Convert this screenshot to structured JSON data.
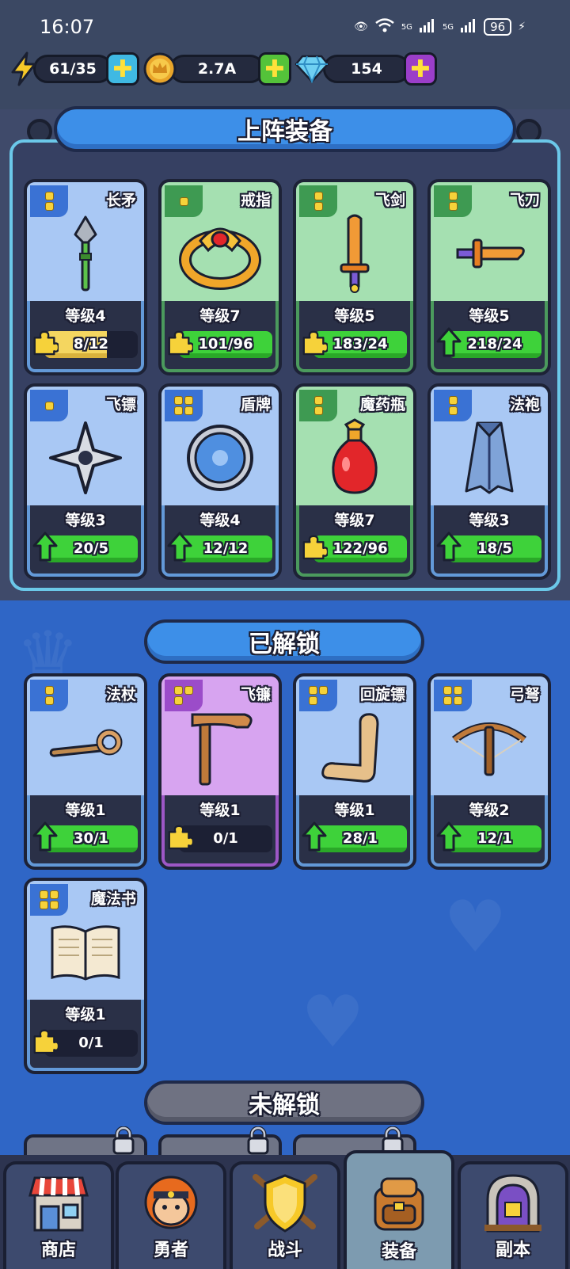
{
  "status_bar": {
    "time": "16:07",
    "battery": "96",
    "net1": "5G",
    "net2": "5G"
  },
  "currencies": [
    {
      "icon": "lightning-icon",
      "value": "61/35",
      "plus_color": "#3fb9e3"
    },
    {
      "icon": "crown-coin-icon",
      "value": "2.7A",
      "plus_color": "#54c33a"
    },
    {
      "icon": "diamond-icon",
      "value": "154",
      "plus_color": "#9b3ec9"
    }
  ],
  "equipped": {
    "title": "上阵装备",
    "items": [
      {
        "name": "长矛",
        "level": "等级4",
        "progress": "8/12",
        "fill": 0.67,
        "color": "blue",
        "badge": "puzzle",
        "rarity": 2,
        "icon": "spear-icon"
      },
      {
        "name": "戒指",
        "level": "等级7",
        "progress": "101/96",
        "fill": 1.0,
        "color": "green",
        "badge": "puzzle",
        "rarity": 1,
        "icon": "ring-icon"
      },
      {
        "name": "飞剑",
        "level": "等级5",
        "progress": "183/24",
        "fill": 1.0,
        "color": "green",
        "badge": "puzzle",
        "rarity": 2,
        "icon": "sword-icon"
      },
      {
        "name": "飞刀",
        "level": "等级5",
        "progress": "218/24",
        "fill": 1.0,
        "color": "green",
        "badge": "arrow",
        "rarity": 2,
        "icon": "dagger-icon"
      },
      {
        "name": "飞镖",
        "level": "等级3",
        "progress": "20/5",
        "fill": 1.0,
        "color": "blue",
        "badge": "arrow",
        "rarity": 1,
        "icon": "shuriken-icon"
      },
      {
        "name": "盾牌",
        "level": "等级4",
        "progress": "12/12",
        "fill": 1.0,
        "color": "blue",
        "badge": "arrow",
        "rarity": 4,
        "icon": "shield-icon"
      },
      {
        "name": "魔药瓶",
        "level": "等级7",
        "progress": "122/96",
        "fill": 1.0,
        "color": "green",
        "badge": "puzzle",
        "rarity": 2,
        "icon": "potion-icon"
      },
      {
        "name": "法袍",
        "level": "等级3",
        "progress": "18/5",
        "fill": 1.0,
        "color": "blue",
        "badge": "arrow",
        "rarity": 2,
        "icon": "robe-icon"
      }
    ]
  },
  "unlocked": {
    "title": "已解锁",
    "items": [
      {
        "name": "法杖",
        "level": "等级1",
        "progress": "30/1",
        "fill": 1.0,
        "color": "blue",
        "badge": "arrow",
        "rarity": 2,
        "icon": "staff-icon"
      },
      {
        "name": "飞镰",
        "level": "等级1",
        "progress": "0/1",
        "fill": 0.0,
        "color": "purple",
        "badge": "puzzle",
        "rarity": 3,
        "icon": "scythe-icon"
      },
      {
        "name": "回旋镖",
        "level": "等级1",
        "progress": "28/1",
        "fill": 1.0,
        "color": "blue",
        "badge": "arrow",
        "rarity": 3,
        "icon": "boomerang-icon"
      },
      {
        "name": "弓弩",
        "level": "等级2",
        "progress": "12/1",
        "fill": 1.0,
        "color": "blue",
        "badge": "arrow",
        "rarity": 4,
        "icon": "crossbow-icon"
      },
      {
        "name": "魔法书",
        "level": "等级1",
        "progress": "0/1",
        "fill": 0.0,
        "color": "blue",
        "badge": "puzzle",
        "rarity": 4,
        "icon": "spellbook-icon"
      }
    ]
  },
  "locked": {
    "title": "未解锁"
  },
  "nav": [
    {
      "label": "商店",
      "icon": "shop-icon",
      "active": false
    },
    {
      "label": "勇者",
      "icon": "hero-icon",
      "active": false
    },
    {
      "label": "战斗",
      "icon": "battle-icon",
      "active": false
    },
    {
      "label": "装备",
      "icon": "backpack-icon",
      "active": true
    },
    {
      "label": "副本",
      "icon": "dungeon-icon",
      "active": false
    }
  ]
}
